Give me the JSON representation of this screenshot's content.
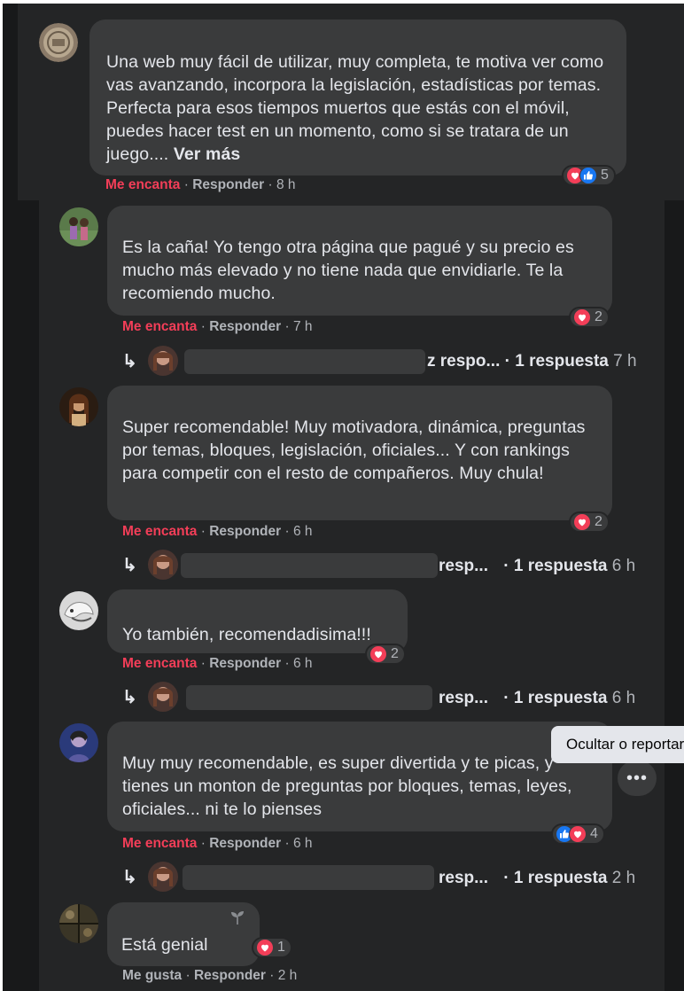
{
  "comments": [
    {
      "text": "Una web muy fácil de utilizar, muy completa, te motiva ver como vas avanzando, incorpora la legislación, estadísticas por temas. Perfecta para esos tiempos muertos que estás con el móvil, puedes hacer test en un momento, como si se tratara de un juego....",
      "see_more": "Ver más",
      "reaction_label": "Me encanta",
      "reply_label": "Responder",
      "time": "8 h",
      "reaction_count": "5",
      "reactions": [
        "heart-icon",
        "like-icon"
      ]
    },
    {
      "text": "Es la caña! Yo tengo otra página que pagué y su precio es mucho más elevado y no tiene nada que envidiarle. Te la recomiendo mucho.",
      "reaction_label": "Me encanta",
      "reply_label": "Responder",
      "time": "7 h",
      "reaction_count": "2",
      "reply_summary": {
        "name_fragment": "z respo...",
        "label": "· 1 respuesta",
        "time": "7 h"
      }
    },
    {
      "text": "Super recomendable! Muy motivadora, dinámica, preguntas por temas, bloques, legislación, oficiales... Y con rankings para competir con el resto de compañeros. Muy chula!",
      "reaction_label": "Me encanta",
      "reply_label": "Responder",
      "time": "6 h",
      "reaction_count": "2",
      "reply_summary": {
        "name_fragment": "resp...",
        "label": "· 1 respuesta",
        "time": "6 h"
      }
    },
    {
      "text": "Yo también, recomendadisima!!!",
      "reaction_label": "Me encanta",
      "reply_label": "Responder",
      "time": "6 h",
      "reaction_count": "2",
      "reply_summary": {
        "name_fragment": "resp...",
        "label": "· 1 respuesta",
        "time": "6 h"
      }
    },
    {
      "text": "Muy muy recomendable, es super divertida y te picas, y tienes un monton de preguntas por bloques, temas, leyes, oficiales... ni te lo pienses",
      "reaction_label": "Me encanta",
      "reply_label": "Responder",
      "time": "6 h",
      "reaction_count": "4",
      "reactions": [
        "like-icon",
        "heart-icon"
      ],
      "reply_summary": {
        "name_fragment": "resp...",
        "label": "· 1 respuesta",
        "time": "2 h"
      }
    },
    {
      "text": "Está genial",
      "reaction_label": "Me gusta",
      "reply_label": "Responder",
      "time": "2 h",
      "reaction_count": "1"
    }
  ],
  "tooltip": "Ocultar o reportar",
  "more_button": "•••",
  "separator": "·",
  "reply_arrow": "↳",
  "colors": {
    "background": "#18191a",
    "bubble": "#3a3b3c",
    "love": "#f33e58",
    "like": "#1877f2",
    "meta": "#b0b3b8"
  }
}
